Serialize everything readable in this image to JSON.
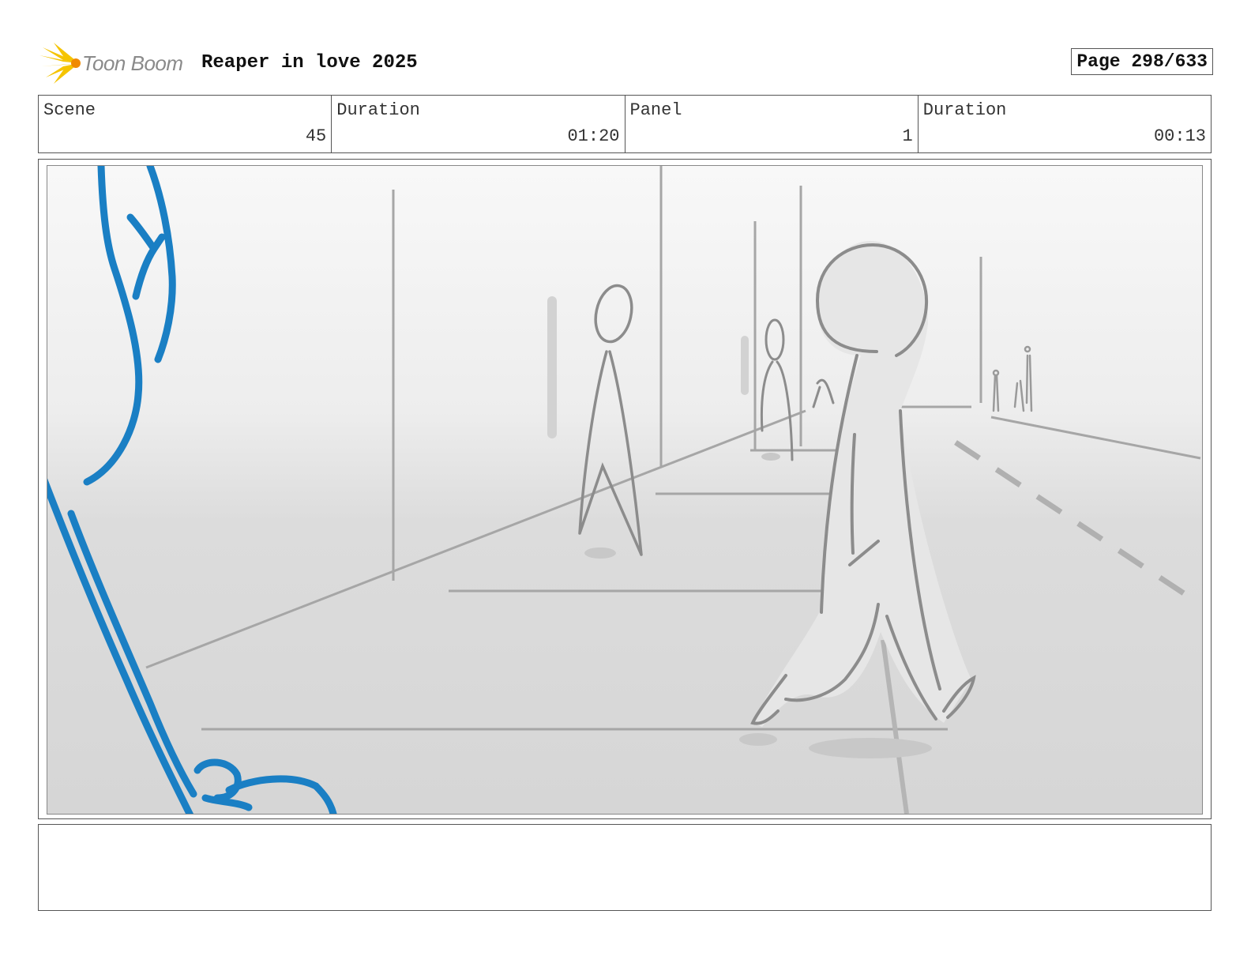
{
  "header": {
    "logo_text": "Toon Boom",
    "project_title": "Reaper in love 2025",
    "page_label": "Page 298/633"
  },
  "info": {
    "scene_label": "Scene",
    "scene_value": "45",
    "scene_duration_label": "Duration",
    "scene_duration_value": "01:20",
    "panel_label": "Panel",
    "panel_value": "1",
    "panel_duration_label": "Duration",
    "panel_duration_value": "00:13"
  },
  "colors": {
    "logo_yellow": "#f5c400",
    "sketch_blue": "#1a7fc4",
    "sketch_gray": "#8c8c8c"
  },
  "notes": ""
}
